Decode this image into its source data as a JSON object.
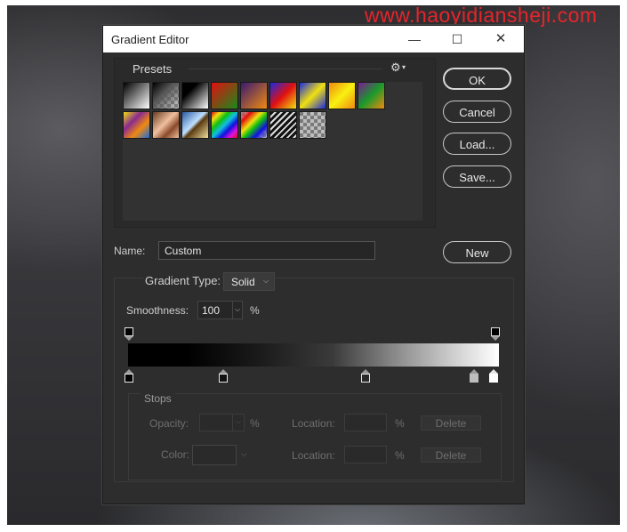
{
  "watermark": "www.haoyidiansheji.com",
  "window": {
    "title": "Gradient Editor",
    "minimize_glyph": "—",
    "maximize_glyph": "☐",
    "close_glyph": "✕"
  },
  "presets": {
    "label": "Presets",
    "gear_glyph": "⚙",
    "swatches": [
      "black-to-white",
      "transparent-checker",
      "black-white-dark",
      "red-green",
      "violet-orange",
      "blue-red-yellow",
      "blue-yellow-blue",
      "orange-yellow-orange",
      "violet-green-orange",
      "yellow-violet-orange-blue",
      "copper",
      "chrome",
      "spectrum",
      "transparent-rainbow",
      "transparent-stripes",
      "neutral-density"
    ]
  },
  "buttons": {
    "ok": "OK",
    "cancel": "Cancel",
    "load": "Load...",
    "save": "Save...",
    "new": "New"
  },
  "name": {
    "label": "Name:",
    "value": "Custom"
  },
  "gradient_type": {
    "label": "Gradient Type:",
    "value": "Solid"
  },
  "smoothness": {
    "label": "Smoothness:",
    "value": "100",
    "unit": "%"
  },
  "stops": {
    "label": "Stops",
    "opacity_label": "Opacity:",
    "opacity_unit": "%",
    "color_label": "Color:",
    "location_label": "Location:",
    "location_unit": "%",
    "delete_label": "Delete"
  },
  "colors": {
    "dialog_bg": "#2d2d2d",
    "text": "#cfcfcf",
    "disabled_text": "#6e6e6e",
    "watermark": "#e8242b"
  }
}
